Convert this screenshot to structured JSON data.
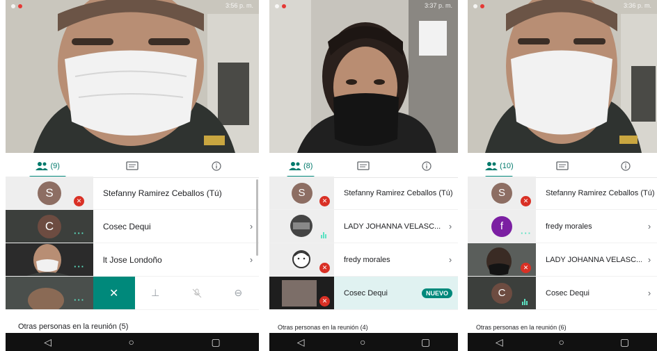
{
  "phones": [
    {
      "tabs": {
        "people_count": "(9)"
      },
      "participants": [
        {
          "name": "Stefanny Ramirez Ceballos (Tú)",
          "initial": "S",
          "avatar_color": "#8d6e63"
        },
        {
          "name": "Cosec Dequi",
          "initial": "C",
          "avatar_color": "#6d4c41"
        },
        {
          "name": "lt Jose Londoño"
        }
      ],
      "others_text": "Otras personas en la reunión (5)"
    },
    {
      "tabs": {
        "people_count": "(8)"
      },
      "participants": [
        {
          "name": "Stefanny Ramirez Ceballos (Tú)",
          "initial": "S",
          "avatar_color": "#8d6e63"
        },
        {
          "name": "LADY JOHANNA VELASC..."
        },
        {
          "name": "fredy morales"
        },
        {
          "name": "Cosec Dequi",
          "badge": "NUEVO"
        }
      ],
      "others_text": "Otras personas en la reunión (4)"
    },
    {
      "tabs": {
        "people_count": "(10)"
      },
      "participants": [
        {
          "name": "Stefanny Ramirez Ceballos (Tú)",
          "initial": "S",
          "avatar_color": "#8d6e63"
        },
        {
          "name": "fredy morales",
          "initial": "f",
          "avatar_color": "#7b1fa2"
        },
        {
          "name": "LADY JOHANNA VELASC..."
        },
        {
          "name": "Cosec Dequi",
          "initial": "C",
          "avatar_color": "#6d4c41"
        }
      ],
      "others_text": "Otras personas en la reunión (6)"
    }
  ],
  "statusbar": {
    "time_1": "3:56 p. m.",
    "time_2": "3:37 p. m.",
    "time_3": "3:36 p. m."
  },
  "colors": {
    "accent": "#00897b",
    "mute_red": "#d93025",
    "nav_bg": "#111111"
  },
  "icons": {
    "chevron": "›",
    "close": "✕",
    "pin": "⊥",
    "mic_off": "🎤",
    "more": "⊖",
    "back": "◁",
    "home": "○",
    "recent": "▢"
  }
}
